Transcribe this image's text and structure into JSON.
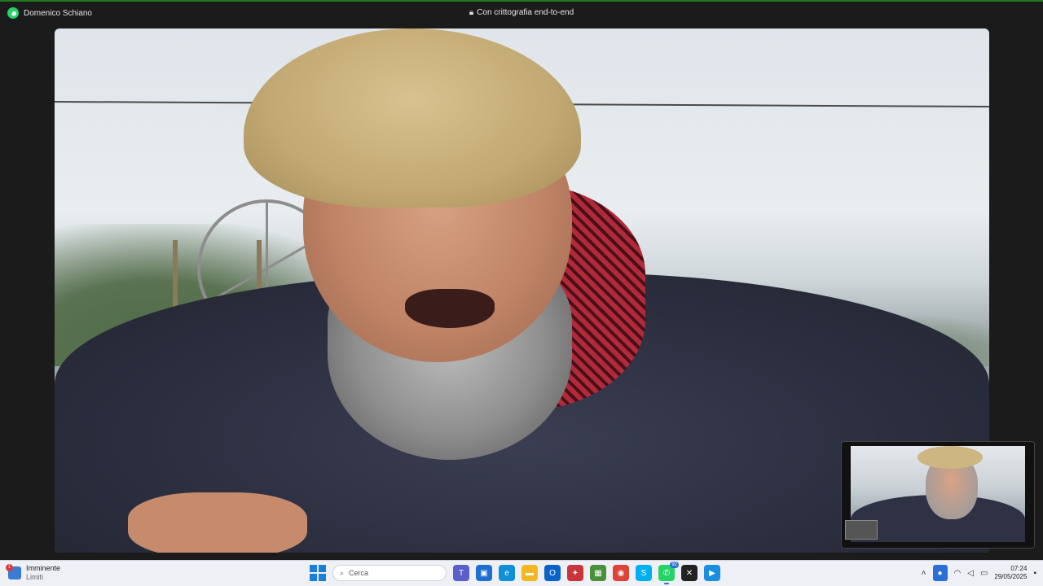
{
  "window": {
    "contact_name": "Domenico Schiano",
    "encryption_label": "Con crittografia end-to-end"
  },
  "call": {
    "remote_participant": "Domenico Schiano",
    "self_view": "self preview"
  },
  "taskbar": {
    "weather": {
      "title": "Imminente",
      "subtitle": "Limiti",
      "badge": "1"
    },
    "search_placeholder": "Cerca",
    "apps": [
      {
        "name": "Teams",
        "color": "#5b5fc7",
        "glyph": "T",
        "count": ""
      },
      {
        "name": "Store",
        "color": "#1f6fd1",
        "glyph": "▣",
        "count": ""
      },
      {
        "name": "Edge",
        "color": "#0f8fd6",
        "glyph": "e",
        "count": ""
      },
      {
        "name": "Esplora file",
        "color": "#f2b824",
        "glyph": "▬",
        "count": ""
      },
      {
        "name": "Outlook",
        "color": "#0a64c8",
        "glyph": "O",
        "count": ""
      },
      {
        "name": "Regalo",
        "color": "#c8363c",
        "glyph": "✦",
        "count": ""
      },
      {
        "name": "Microsoft",
        "color": "#4a8f3c",
        "glyph": "▦",
        "count": ""
      },
      {
        "name": "Chrome",
        "color": "#db4437",
        "glyph": "◉",
        "count": ""
      },
      {
        "name": "Skype",
        "color": "#00aff0",
        "glyph": "S",
        "count": ""
      },
      {
        "name": "WhatsApp",
        "color": "#25d366",
        "glyph": "✆",
        "count": "92"
      },
      {
        "name": "CapCut",
        "color": "#222222",
        "glyph": "✕",
        "count": ""
      },
      {
        "name": "Play",
        "color": "#1a8fe0",
        "glyph": "▶",
        "count": ""
      }
    ],
    "clock": {
      "time": "07:24",
      "date": "29/05/2025"
    }
  },
  "colors": {
    "accent": "#25d366",
    "taskbar_bg": "#eef0f5",
    "window_bg": "#1b1b1b"
  }
}
